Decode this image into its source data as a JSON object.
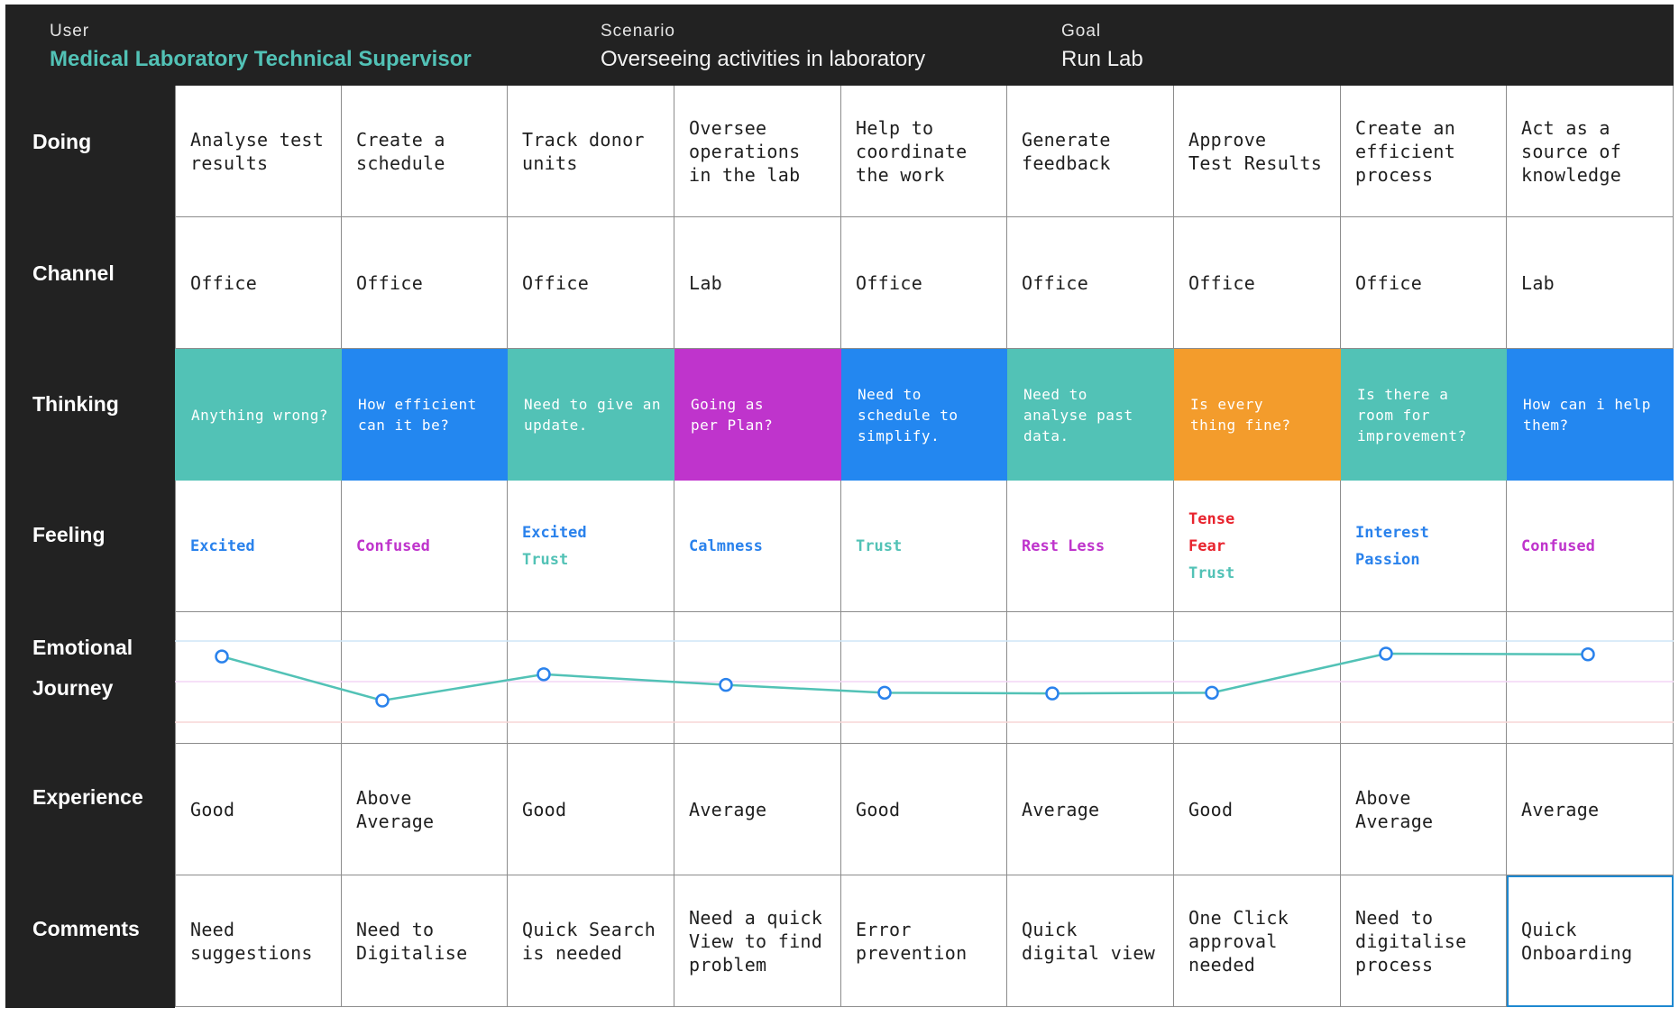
{
  "header": {
    "user_label": "User",
    "user_value": "Medical Laboratory Technical Supervisor",
    "scenario_label": "Scenario",
    "scenario_value": "Overseeing  activities in  laboratory",
    "goal_label": "Goal",
    "goal_value": "Run Lab"
  },
  "rows": {
    "doing": "Doing",
    "channel": "Channel",
    "thinking": "Thinking",
    "feeling": "Feeling",
    "journey_line1": "Emotional",
    "journey_line2": "Journey",
    "experience": "Experience",
    "comments": "Comments"
  },
  "colors": {
    "teal": "#52c2b6",
    "blue": "#2387f0",
    "purple": "#bf34cc",
    "orange": "#f39c2c",
    "line": "#52c2b6",
    "point": "#2a82ec",
    "feel_blue": "#2a82ec",
    "feel_purple": "#bf34cc",
    "feel_teal": "#52c2b6",
    "feel_red": "#e8232d"
  },
  "columns": [
    {
      "doing": "Analyse test\nresults",
      "channel": "Office",
      "thinking": "Anything wrong?",
      "thinking_color": "teal",
      "feelings": [
        {
          "text": "Excited",
          "color": "feel_blue"
        }
      ],
      "journey": 0.62,
      "experience": "Good",
      "comment": "Need\nsuggestions"
    },
    {
      "doing": "Create a\nschedule",
      "channel": "Office",
      "thinking": "How efficient\ncan it be?",
      "thinking_color": "blue",
      "feelings": [
        {
          "text": "Confused",
          "color": "feel_purple"
        }
      ],
      "journey": 0.0,
      "experience": "Above\nAverage",
      "comment": "Need to\nDigitalise"
    },
    {
      "doing": "Track donor\nunits",
      "channel": "Office",
      "thinking": "Need to give an\nupdate.",
      "thinking_color": "teal",
      "feelings": [
        {
          "text": "Excited",
          "color": "feel_blue"
        },
        {
          "text": "Trust",
          "color": "feel_teal"
        }
      ],
      "journey": 0.37,
      "experience": "Good",
      "comment": "Quick Search\nis needed"
    },
    {
      "doing": "Oversee\noperations\nin the lab",
      "channel": "Lab",
      "thinking": "Going as\nper Plan?",
      "thinking_color": "purple",
      "feelings": [
        {
          "text": "Calmness",
          "color": "feel_blue"
        }
      ],
      "journey": 0.22,
      "experience": "Average",
      "comment": "Need a quick\nView to find\nproblem"
    },
    {
      "doing": "Help to\ncoordinate\nthe work",
      "channel": "Office",
      "thinking": "Need to\nschedule to\nsimplify.",
      "thinking_color": "blue",
      "feelings": [
        {
          "text": "Trust",
          "color": "feel_teal"
        }
      ],
      "journey": 0.11,
      "experience": "Good",
      "comment": "Error\nprevention"
    },
    {
      "doing": "Generate\nfeedback",
      "channel": "Office",
      "thinking": "Need to\nanalyse past\ndata.",
      "thinking_color": "teal",
      "feelings": [
        {
          "text": "Rest Less",
          "color": "feel_purple"
        }
      ],
      "journey": 0.1,
      "experience": "Average",
      "comment": "Quick\ndigital view"
    },
    {
      "doing": "Approve\nTest Results",
      "channel": "Office",
      "thinking": "Is every\nthing fine?",
      "thinking_color": "orange",
      "feelings": [
        {
          "text": "Tense",
          "color": "feel_red"
        },
        {
          "text": "Fear",
          "color": "feel_red"
        },
        {
          "text": "Trust",
          "color": "feel_teal"
        }
      ],
      "journey": 0.11,
      "experience": "Good",
      "comment": "One Click\napproval\nneeded"
    },
    {
      "doing": "Create an\nefficient\nprocess",
      "channel": "Office",
      "thinking": "Is there a\nroom for\nimprovement?",
      "thinking_color": "teal",
      "feelings": [
        {
          "text": "Interest",
          "color": "feel_blue"
        },
        {
          "text": "Passion",
          "color": "feel_blue"
        }
      ],
      "journey": 0.66,
      "experience": "Above\nAverage",
      "comment": "Need to\ndigitalise\nprocess"
    },
    {
      "doing": "Act as a\nsource of\nknowledge",
      "channel": "Lab",
      "thinking": "How can i help\nthem?",
      "thinking_color": "blue",
      "feelings": [
        {
          "text": "Confused",
          "color": "feel_purple"
        }
      ],
      "journey": 0.65,
      "experience": "Average",
      "comment": "Quick\nOnboarding"
    }
  ]
}
